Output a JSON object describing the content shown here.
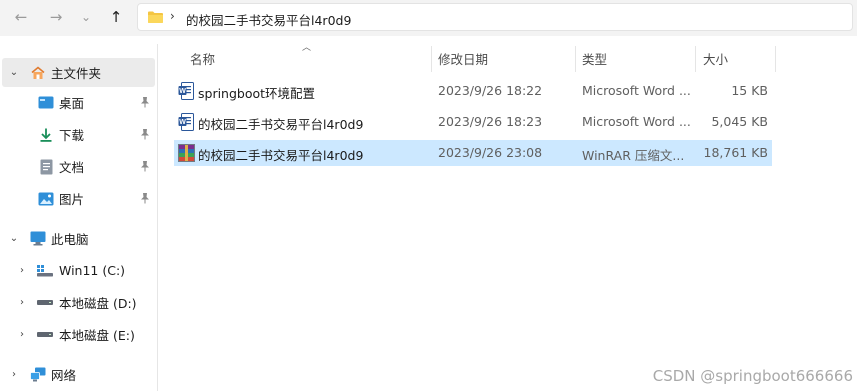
{
  "address_bar": {
    "path": "的校园二手书交易平台l4r0d9",
    "separator": "›"
  },
  "nav_buttons": {
    "back": "←",
    "forward": "→",
    "recent": "⌄",
    "up": "↑"
  },
  "sidebar": {
    "items": [
      {
        "label": "主文件夹",
        "icon": "home-icon",
        "expanded": true
      },
      {
        "label": "桌面",
        "icon": "desktop-icon",
        "pinned": true
      },
      {
        "label": "下载",
        "icon": "download-icon",
        "pinned": true
      },
      {
        "label": "文档",
        "icon": "document-icon",
        "pinned": true
      },
      {
        "label": "图片",
        "icon": "picture-icon",
        "pinned": true
      },
      {
        "label": "此电脑",
        "icon": "computer-icon",
        "expanded": true
      },
      {
        "label": "Win11 (C:)",
        "icon": "windows-drive-icon"
      },
      {
        "label": "本地磁盘 (D:)",
        "icon": "disk-drive-icon"
      },
      {
        "label": "本地磁盘 (E:)",
        "icon": "disk-drive-icon"
      },
      {
        "label": "网络",
        "icon": "network-icon"
      }
    ]
  },
  "columns": {
    "name": "名称",
    "modified": "修改日期",
    "type": "类型",
    "size": "大小"
  },
  "files": [
    {
      "name": "springboot环境配置",
      "modified": "2023/9/26 18:22",
      "type": "Microsoft Word ...",
      "size": "15 KB",
      "icon": "word-document-icon"
    },
    {
      "name": "的校园二手书交易平台l4r0d9",
      "modified": "2023/9/26 18:23",
      "type": "Microsoft Word ...",
      "size": "5,045 KB",
      "icon": "word-document-icon"
    },
    {
      "name": "的校园二手书交易平台l4r0d9",
      "modified": "2023/9/26 23:08",
      "type": "WinRAR 压缩文...",
      "size": "18,761 KB",
      "icon": "winrar-archive-icon",
      "selected": true
    }
  ],
  "watermark": "CSDN @springboot666666",
  "colors": {
    "selection": "#cce8ff",
    "folder": "#f4c542",
    "word": "#2b579a"
  }
}
